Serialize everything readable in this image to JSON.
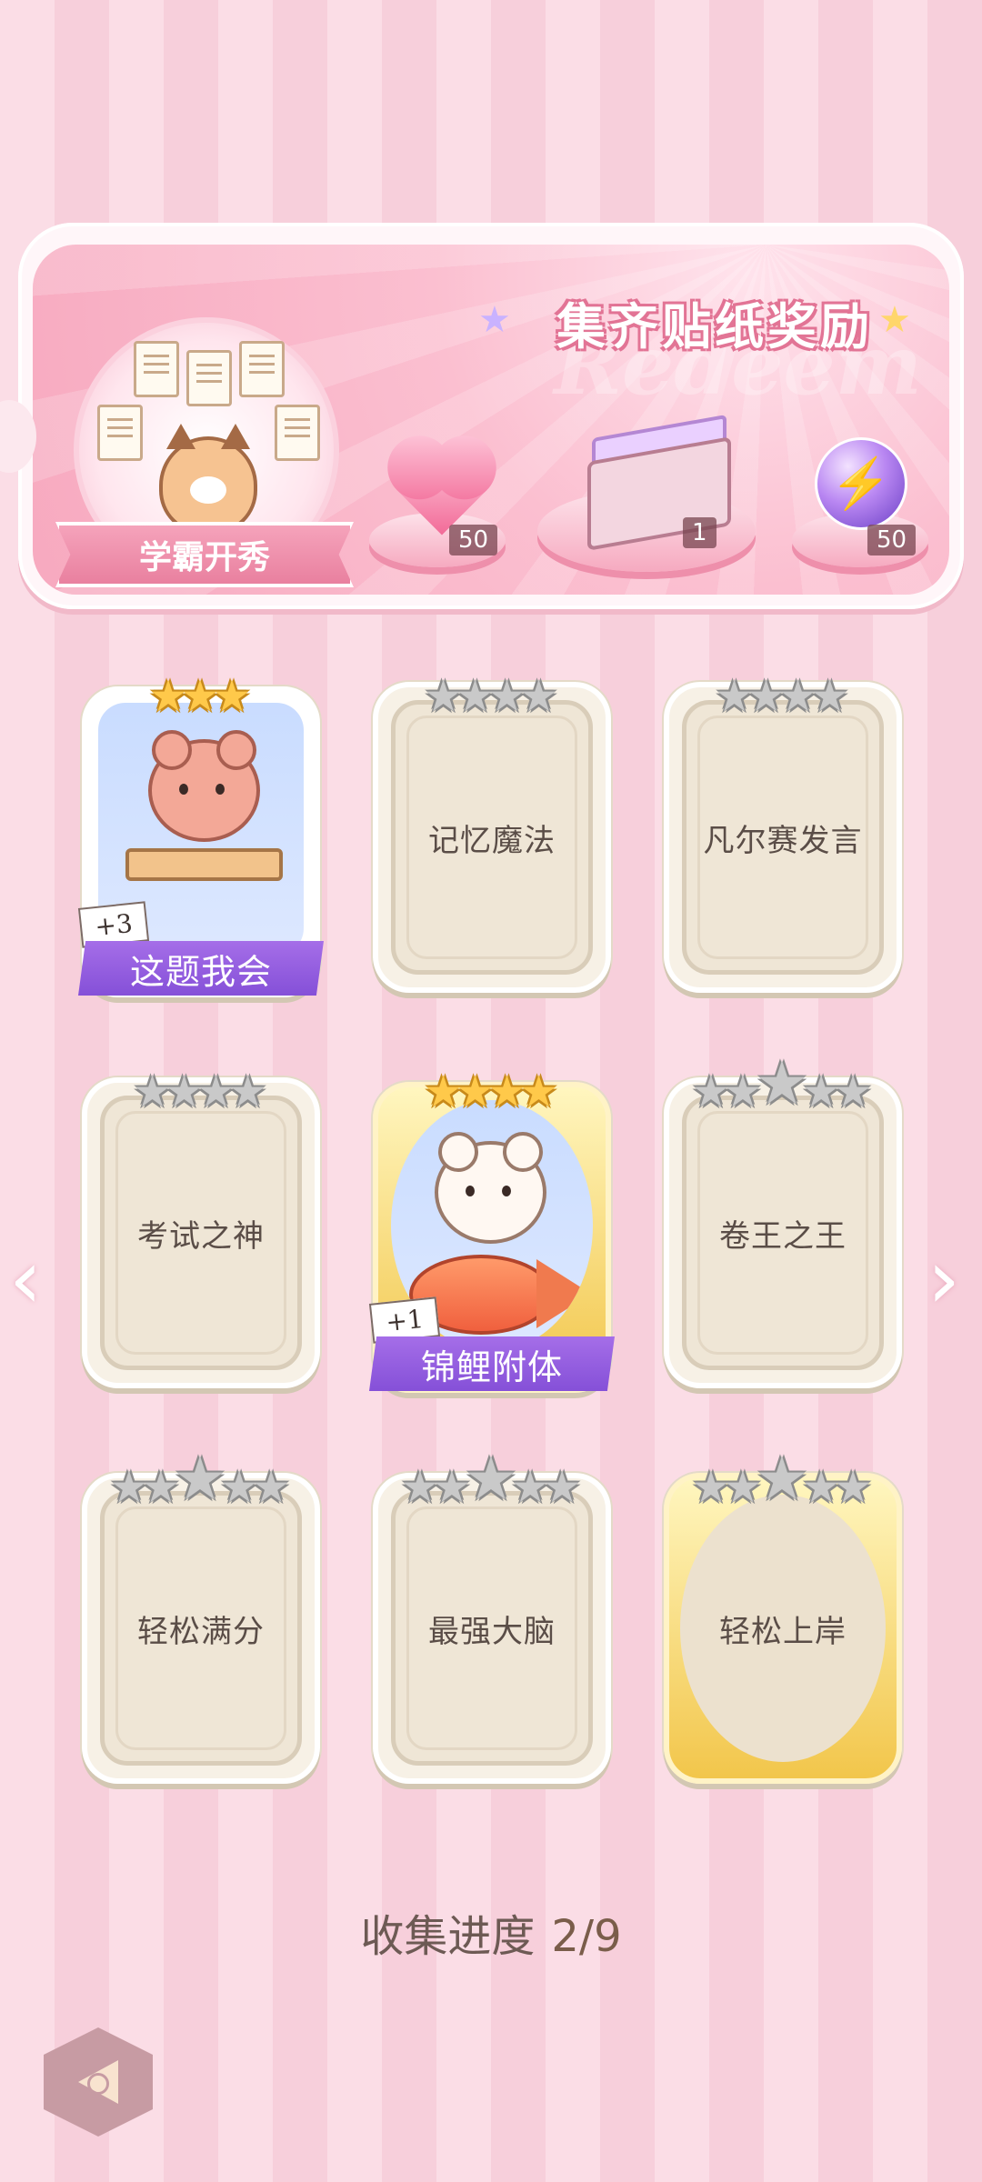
{
  "banner": {
    "title": "集齐贴纸奖励",
    "watermark": "Redeem",
    "portrait_label": "学霸开秀",
    "rewards": [
      {
        "icon": "pink-heart-gem-icon",
        "count": "50"
      },
      {
        "icon": "gift-box-icon",
        "count": "1"
      },
      {
        "icon": "purple-energy-orb-icon",
        "count": "50"
      }
    ]
  },
  "cards": [
    {
      "label": "这题我会",
      "collected": true,
      "stars_filled": 3,
      "stars_total": 3,
      "bonus": "+3"
    },
    {
      "label": "记忆魔法",
      "collected": false,
      "stars_filled": 0,
      "stars_total": 4
    },
    {
      "label": "凡尔赛发言",
      "collected": false,
      "stars_filled": 0,
      "stars_total": 4
    },
    {
      "label": "考试之神",
      "collected": false,
      "stars_filled": 0,
      "stars_total": 4
    },
    {
      "label": "锦鲤附体",
      "collected": true,
      "stars_filled": 4,
      "stars_total": 4,
      "bonus": "+1"
    },
    {
      "label": "卷王之王",
      "collected": false,
      "stars_filled": 0,
      "stars_total": 5
    },
    {
      "label": "轻松满分",
      "collected": false,
      "stars_filled": 0,
      "stars_total": 5
    },
    {
      "label": "最强大脑",
      "collected": false,
      "stars_filled": 0,
      "stars_total": 5
    },
    {
      "label": "轻松上岸",
      "collected": false,
      "stars_filled": 0,
      "stars_total": 5
    }
  ],
  "nav": {
    "prev_icon": "chevron-left-icon",
    "next_icon": "chevron-right-icon",
    "back_icon": "back-arrow-icon"
  },
  "progress": {
    "label": "收集进度",
    "value": "2/9",
    "collected": 2,
    "total": 9
  },
  "colors": {
    "accent_pink": "#f7a9bf",
    "banner_purple": "#8550d8",
    "gold": "#ffc94a"
  }
}
